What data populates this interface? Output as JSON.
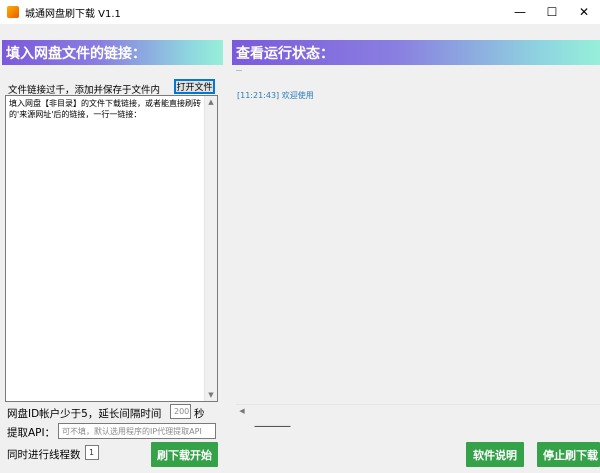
{
  "window": {
    "title": "城通网盘刷下载 V1.1",
    "minimize_glyph": "—",
    "maximize_glyph": "☐",
    "close_glyph": "✕"
  },
  "left_panel": {
    "header": "填入网盘文件的链接：",
    "hint": "文件链接过千，添加并保存于文件内",
    "open_file_button": "打开文件",
    "links_text": "填入网盘【非目录】的文件下载链接，或者能直接刷砖的'来源网址'后的链接，一行一链接：",
    "account_label": "网盘ID帐户少于5，延长间隔时间",
    "interval_value": "200",
    "interval_unit": "秒",
    "api_label": "提取API：",
    "api_placeholder": "可不填，默认选用程序的IP代理提取API",
    "threads_label": "同时进行线程数",
    "threads_value": "1",
    "start_button": "刷下载开始"
  },
  "right_panel": {
    "header": "查看运行状态：",
    "log": [
      {
        "time": "[11:21:43]",
        "message": "欢迎使用"
      }
    ],
    "status_line": "————",
    "manual_button": "软件说明",
    "stop_button": "停止刷下载"
  },
  "colors": {
    "header_gradient_start": "#7b59dd",
    "header_gradient_end": "#96f0d8",
    "action_green": "#35a24a",
    "log_text": "#2b7bb9"
  }
}
